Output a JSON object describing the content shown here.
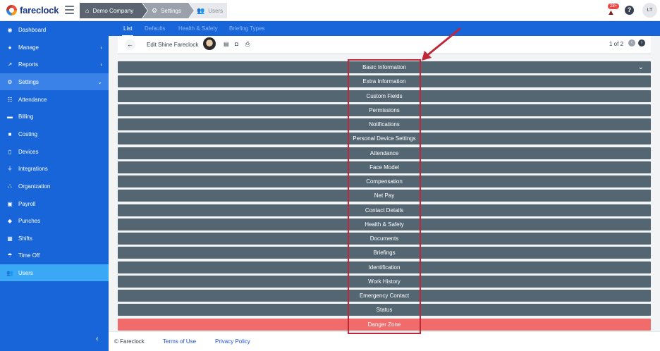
{
  "app": {
    "name": "fareclock",
    "user_initials": "LT",
    "notification_count": "28+"
  },
  "breadcrumbs": [
    {
      "label": "Demo Company",
      "icon": "home-icon"
    },
    {
      "label": "Settings",
      "icon": "gear-icon"
    },
    {
      "label": "Users",
      "icon": "users-icon"
    }
  ],
  "sidebar": {
    "items": [
      {
        "label": "Dashboard",
        "icon": "dashboard-icon"
      },
      {
        "label": "Manage",
        "icon": "user-icon",
        "chevron": "left"
      },
      {
        "label": "Reports",
        "icon": "chart-icon",
        "chevron": "left"
      },
      {
        "label": "Settings",
        "icon": "gear-icon",
        "chevron": "down",
        "state": "expanded"
      },
      {
        "label": "Attendance",
        "icon": "list-icon"
      },
      {
        "label": "Billing",
        "icon": "billing-icon"
      },
      {
        "label": "Costing",
        "icon": "folder-icon"
      },
      {
        "label": "Devices",
        "icon": "device-icon"
      },
      {
        "label": "Integrations",
        "icon": "plug-icon"
      },
      {
        "label": "Organization",
        "icon": "org-icon"
      },
      {
        "label": "Payroll",
        "icon": "money-icon"
      },
      {
        "label": "Punches",
        "icon": "punch-icon"
      },
      {
        "label": "Shifts",
        "icon": "calendar-icon"
      },
      {
        "label": "Time Off",
        "icon": "umbrella-icon"
      },
      {
        "label": "Users",
        "icon": "users-icon",
        "state": "active"
      }
    ]
  },
  "tabs": [
    {
      "label": "List",
      "active": true
    },
    {
      "label": "Defaults"
    },
    {
      "label": "Health & Safety"
    },
    {
      "label": "Briefing Types"
    }
  ],
  "subheader": {
    "title": "Edit Shine Fareclock",
    "pager": "1 of 2"
  },
  "sections": [
    "Basic Information",
    "Extra Information",
    "Custom Fields",
    "Permissions",
    "Notifications",
    "Personal Device Settings",
    "Attendance",
    "Face Model",
    "Compensation",
    "Net Pay",
    "Contact Details",
    "Health & Safety",
    "Documents",
    "Briefings",
    "Identification",
    "Work History",
    "Emergency Contact",
    "Status",
    "Danger Zone"
  ],
  "footer": {
    "copyright": "© Fareclock",
    "terms": "Terms of Use",
    "privacy": "Privacy Policy"
  },
  "colors": {
    "sidebar": "#1765d8",
    "section_bar": "#546672",
    "danger": "#f16b6b",
    "annotation": "#c0283a"
  }
}
